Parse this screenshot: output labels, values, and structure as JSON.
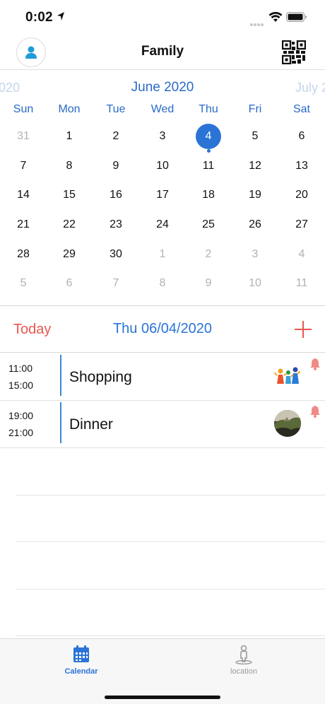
{
  "status": {
    "time": "0:02"
  },
  "header": {
    "title": "Family"
  },
  "calendar": {
    "month_prev": "2020",
    "month_current": "June 2020",
    "month_next": "July 2",
    "weekdays": [
      "Sun",
      "Mon",
      "Tue",
      "Wed",
      "Thu",
      "Fri",
      "Sat"
    ],
    "weeks": [
      [
        {
          "d": "31",
          "m": true
        },
        {
          "d": "1"
        },
        {
          "d": "2"
        },
        {
          "d": "3"
        },
        {
          "d": "4",
          "sel": true,
          "dot": true
        },
        {
          "d": "5"
        },
        {
          "d": "6"
        }
      ],
      [
        {
          "d": "7"
        },
        {
          "d": "8"
        },
        {
          "d": "9"
        },
        {
          "d": "10"
        },
        {
          "d": "11"
        },
        {
          "d": "12"
        },
        {
          "d": "13"
        }
      ],
      [
        {
          "d": "14"
        },
        {
          "d": "15"
        },
        {
          "d": "16"
        },
        {
          "d": "17"
        },
        {
          "d": "18"
        },
        {
          "d": "19"
        },
        {
          "d": "20"
        }
      ],
      [
        {
          "d": "21"
        },
        {
          "d": "22"
        },
        {
          "d": "23"
        },
        {
          "d": "24"
        },
        {
          "d": "25"
        },
        {
          "d": "26"
        },
        {
          "d": "27"
        }
      ],
      [
        {
          "d": "28"
        },
        {
          "d": "29"
        },
        {
          "d": "30"
        },
        {
          "d": "1",
          "m": true
        },
        {
          "d": "2",
          "m": true
        },
        {
          "d": "3",
          "m": true
        },
        {
          "d": "4",
          "m": true
        }
      ],
      [
        {
          "d": "5",
          "m": true
        },
        {
          "d": "6",
          "m": true
        },
        {
          "d": "7",
          "m": true
        },
        {
          "d": "8",
          "m": true
        },
        {
          "d": "9",
          "m": true
        },
        {
          "d": "10",
          "m": true
        },
        {
          "d": "11",
          "m": true
        }
      ]
    ]
  },
  "day_header": {
    "today_label": "Today",
    "date_title": "Thu 06/04/2020"
  },
  "events": [
    {
      "start": "11:00",
      "end": "15:00",
      "title": "Shopping",
      "image": "family-icon"
    },
    {
      "start": "19:00",
      "end": "21:00",
      "title": "Dinner",
      "image": "landscape-photo"
    }
  ],
  "tabbar": {
    "calendar_label": "Calendar",
    "location_label": "location"
  },
  "colors": {
    "accent": "#2a74d6",
    "today_red": "#e8574f",
    "muted": "#b2b2b2"
  }
}
